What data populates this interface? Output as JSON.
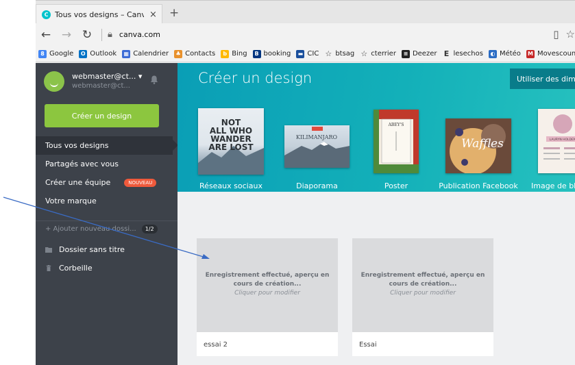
{
  "browser": {
    "tab_title": "Tous vos designs – Canv",
    "tab_close": "×",
    "new_tab": "+",
    "url": "canva.com",
    "bookmarks": [
      {
        "label": "Google",
        "color": "#4285f4",
        "glyph": "8"
      },
      {
        "label": "Outlook",
        "color": "#0072c6",
        "glyph": "O"
      },
      {
        "label": "Calendrier",
        "color": "#3c6bd6",
        "glyph": "▦"
      },
      {
        "label": "Contacts",
        "color": "#e8912d",
        "glyph": "♣"
      },
      {
        "label": "Bing",
        "color": "#ffb900",
        "glyph": "b"
      },
      {
        "label": "booking",
        "color": "#003580",
        "glyph": "B"
      },
      {
        "label": "CIC",
        "color": "#1a4f9c",
        "glyph": "▬"
      },
      {
        "label": "btsag",
        "color": "none",
        "glyph": "☆"
      },
      {
        "label": "cterrier",
        "color": "none",
        "glyph": "☆"
      },
      {
        "label": "Deezer",
        "color": "#222222",
        "glyph": "≡"
      },
      {
        "label": "lesechos",
        "color": "none",
        "glyph": "E"
      },
      {
        "label": "Météo",
        "color": "#2b6cc4",
        "glyph": "◐"
      },
      {
        "label": "Movescount",
        "color": "#c62828",
        "glyph": "M"
      }
    ]
  },
  "sidebar": {
    "user_name": "webmaster@ct... ▾",
    "user_sub": "webmaster@ct...",
    "create_button": "Créer un design",
    "menu": [
      {
        "label": "Tous vos designs",
        "active": true
      },
      {
        "label": "Partagés avec vous",
        "active": false
      },
      {
        "label": "Créer une équipe",
        "active": false,
        "badge": "NOUVEAU"
      },
      {
        "label": "Votre marque",
        "active": false
      }
    ],
    "add_folder": "+ Ajouter nouveau dossi...",
    "folder_count": "1/2",
    "folders": [
      {
        "label": "Dossier sans titre",
        "icon": "folder-icon"
      },
      {
        "label": "Corbeille",
        "icon": "trash-icon"
      }
    ]
  },
  "banner": {
    "title": "Créer un design",
    "custom_button": "Utiliser des dime",
    "templates": [
      {
        "label": "Réseaux sociaux",
        "thumb_text": "NOT ALL WHO WANDER ARE LOST"
      },
      {
        "label": "Diaporama",
        "thumb_text": "KILIMANJARO"
      },
      {
        "label": "Poster",
        "thumb_text": "ABEY'S"
      },
      {
        "label": "Publication Facebook",
        "thumb_text": "Waffles"
      },
      {
        "label": "Image de blo",
        "thumb_text": "LAURYN HOLDEN"
      }
    ]
  },
  "designs": [
    {
      "status": "Enregistrement effectué, aperçu en cours de création...",
      "hint": "Cliquer pour modifier",
      "name": "essai 2"
    },
    {
      "status": "Enregistrement effectué, aperçu en cours de création...",
      "hint": "Cliquer pour modifier",
      "name": "Essai"
    }
  ],
  "colors": {
    "sidebar": "#3d424a",
    "accent_green": "#8cc63f",
    "banner_teal": "#13b0b9",
    "badge_red": "#ef5a3c",
    "annotation_arrow": "#3a6bc4"
  }
}
